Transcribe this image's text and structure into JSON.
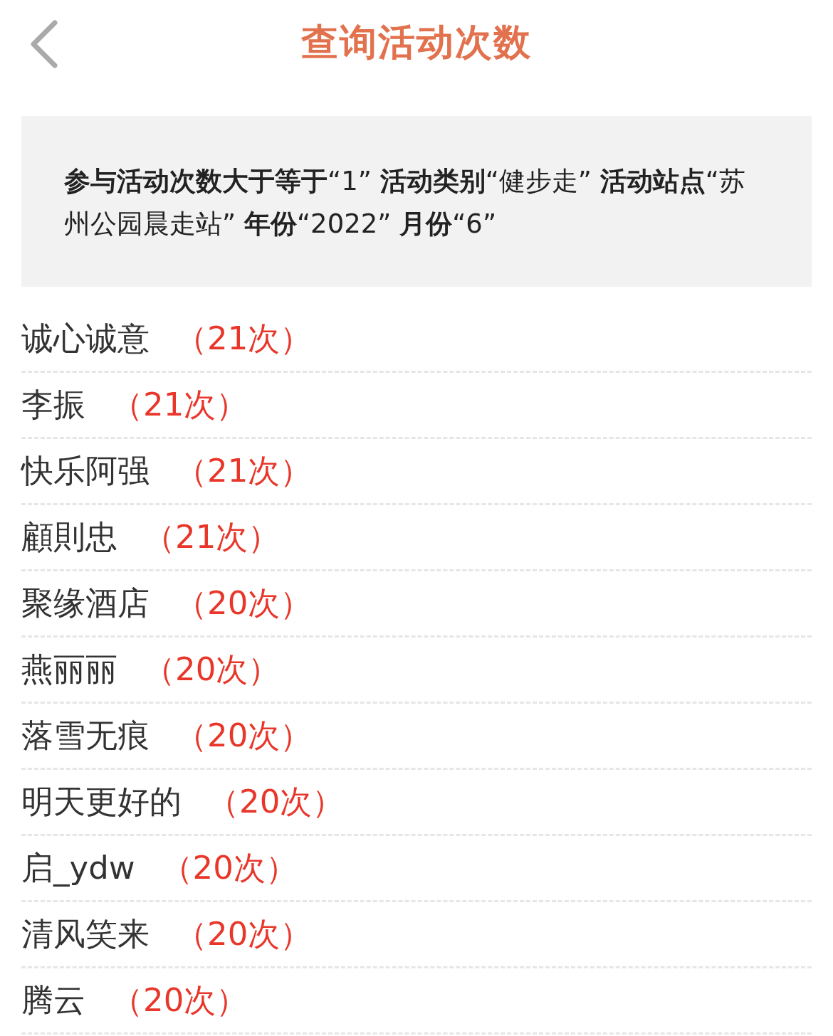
{
  "header": {
    "title": "查询活动次数"
  },
  "filter": {
    "text": "**参与活动次数大于等于**“1” **活动类别**“健步走” **活动站点**“苏州公园晨走站” **年份**“2022” **月份**“6”"
  },
  "rows": [
    {
      "name": "诚心诚意",
      "count": "（21次）"
    },
    {
      "name": "李振",
      "count": "（21次）"
    },
    {
      "name": "快乐阿强",
      "count": "（21次）"
    },
    {
      "name": "顧則忠",
      "count": "（21次）"
    },
    {
      "name": "聚缘酒店",
      "count": "（20次）"
    },
    {
      "name": "燕丽丽",
      "count": "（20次）"
    },
    {
      "name": "落雪无痕",
      "count": "（20次）"
    },
    {
      "name": "明天更好的",
      "count": "（20次）"
    },
    {
      "name": "启_ydw",
      "count": "（20次）"
    },
    {
      "name": "清风笑来",
      "count": "（20次）"
    },
    {
      "name": "腾云",
      "count": "（20次）"
    }
  ]
}
